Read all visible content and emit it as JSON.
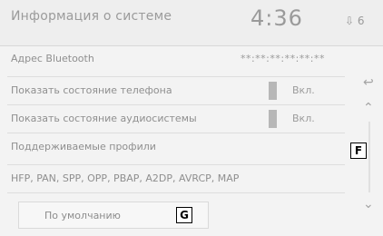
{
  "header": {
    "title": "Информация о системе",
    "time": "4:36",
    "status": "⇩ 6"
  },
  "rows": [
    {
      "label": "Адрес Bluetooth",
      "value": "**:**:**:**:**:**"
    },
    {
      "label": "Показать состояние телефона",
      "toggle_text": "Вкл."
    },
    {
      "label": "Показать состояние аудиосистемы",
      "toggle_text": "Вкл."
    }
  ],
  "profiles": {
    "label": "Поддерживаемые профили",
    "value": "HFP, PAN, SPP, OPP, PBAP, A2DP, AVRCP, MAP"
  },
  "default_button": {
    "label": "По умолчанию"
  },
  "sidebar": {
    "back_icon": "back-icon",
    "up_icon": "up-arrow-icon",
    "down_icon": "down-arrow-icon"
  },
  "callouts": {
    "f": "F",
    "g": "G"
  }
}
